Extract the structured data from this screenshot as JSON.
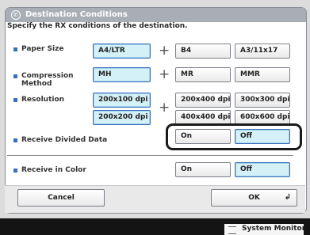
{
  "window": {
    "title": "Destination Conditions",
    "icon": "destination-icon"
  },
  "instruction": "Specify the RX conditions of the destination.",
  "rows": {
    "paper_size": {
      "label": "Paper Size",
      "opt1": "A4/LTR",
      "opt2": "B4",
      "opt3": "A3/11x17"
    },
    "compression": {
      "label_line1": "Compression",
      "label_line2": "Method",
      "opt1": "MH",
      "opt2": "MR",
      "opt3": "MMR"
    },
    "resolution": {
      "label": "Resolution",
      "opt1": "200x100 dpi",
      "opt2": "200x200 dpi",
      "opt3": "200x400 dpi",
      "opt4": "300x300 dpi",
      "opt5": "400x400 dpi",
      "opt6": "600x600 dpi"
    },
    "divided": {
      "label": "Receive Divided Data",
      "on": "On",
      "off": "Off"
    },
    "color": {
      "label": "Receive in Color",
      "on": "On",
      "off": "Off"
    }
  },
  "plus_sign": "+",
  "footer": {
    "cancel": "Cancel",
    "ok": "OK",
    "return_glyph": "↲"
  },
  "status_bar": {
    "system_monitor": "System Monitor",
    "arrow": "›"
  },
  "colors": {
    "selected_fill": "#d4f1f7",
    "selected_border": "#3c6dbb",
    "title_bar": "#a9aeb6",
    "bullet": "#3b6fb5"
  }
}
